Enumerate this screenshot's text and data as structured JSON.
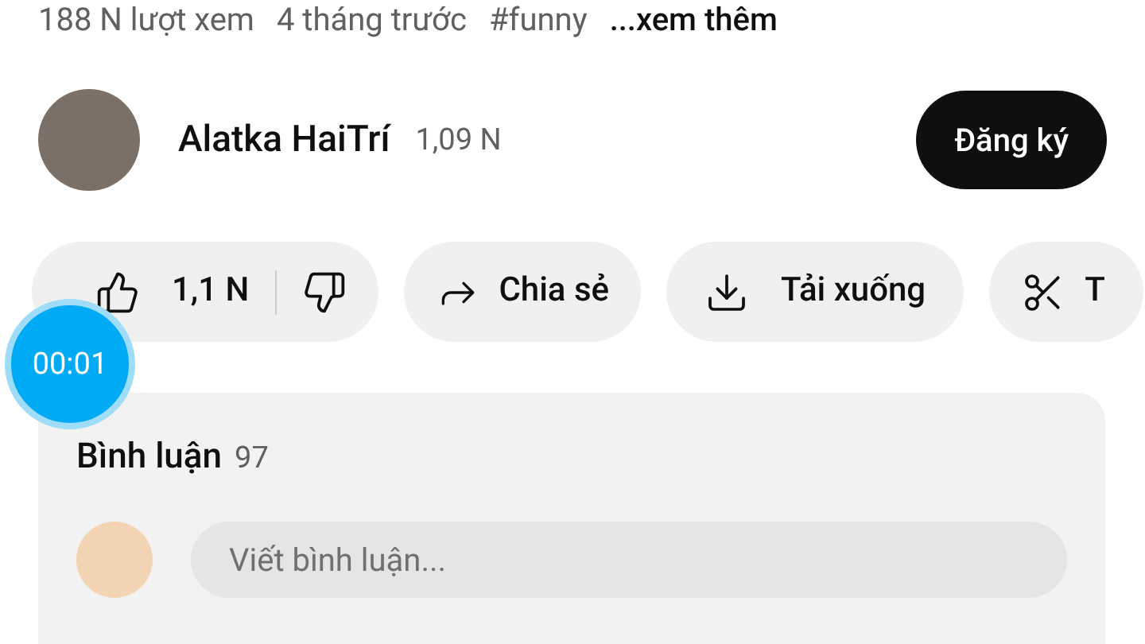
{
  "meta": {
    "views": "188 N lượt xem",
    "age": "4 tháng trước",
    "hashtag": "#funny",
    "more": "...xem thêm"
  },
  "channel": {
    "name": "Alatka HaiTrí",
    "subscribers": "1,09 N",
    "subscribe_button": "Đăng ký"
  },
  "actions": [
    {
      "kind": "like",
      "label": "1,1 N"
    },
    {
      "kind": "share",
      "label": "Chia sẻ"
    },
    {
      "kind": "download",
      "label": "Tải xuống"
    },
    {
      "kind": "clip",
      "label": "T"
    }
  ],
  "timer": "00:01",
  "comments": {
    "title": "Bình luận",
    "count": "97",
    "placeholder": "Viết bình luận..."
  }
}
